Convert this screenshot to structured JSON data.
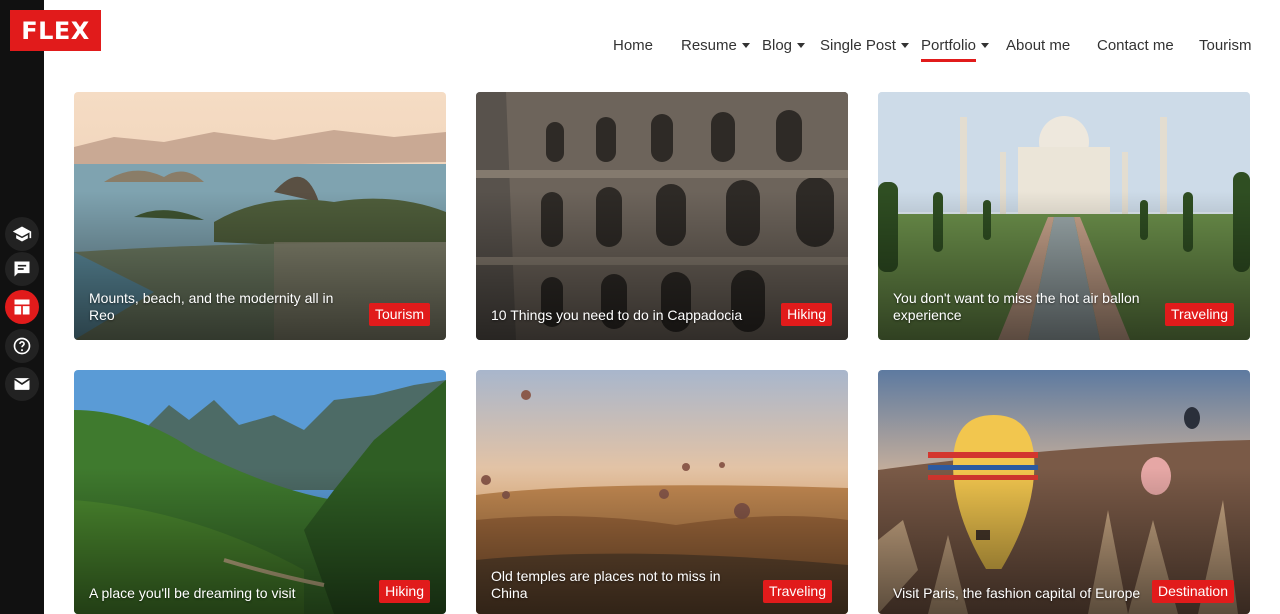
{
  "brand": {
    "logo_text": "FLEX"
  },
  "nav": {
    "items": [
      {
        "label": "Home"
      },
      {
        "label": "Resume"
      },
      {
        "label": "Blog"
      },
      {
        "label": "Single Post"
      },
      {
        "label": "Portfolio",
        "active": true
      },
      {
        "label": "About me"
      },
      {
        "label": "Contact me"
      },
      {
        "label": "Tourism"
      }
    ]
  },
  "sidebar": {
    "icons": [
      {
        "name": "graduation-cap-icon"
      },
      {
        "name": "chat-list-icon"
      },
      {
        "name": "portfolio-grid-icon",
        "active": true
      },
      {
        "name": "help-circle-icon"
      },
      {
        "name": "mail-icon"
      }
    ]
  },
  "cards": [
    {
      "title": "Mounts, beach, and the modernity all in Reo",
      "tag": "Tourism"
    },
    {
      "title": "10 Things you need to do in Cappadocia",
      "tag": "Hiking"
    },
    {
      "title": "You don't want to miss the hot air ballon experience",
      "tag": "Traveling"
    },
    {
      "title": "A place you'll be dreaming to visit",
      "tag": "Hiking"
    },
    {
      "title": "Old temples are places not to miss in China",
      "tag": "Traveling"
    },
    {
      "title": "Visit Paris, the fashion capital of Europe",
      "tag": "Destination"
    }
  ],
  "colors": {
    "accent": "#e11b1b",
    "sidebar": "#111111"
  }
}
